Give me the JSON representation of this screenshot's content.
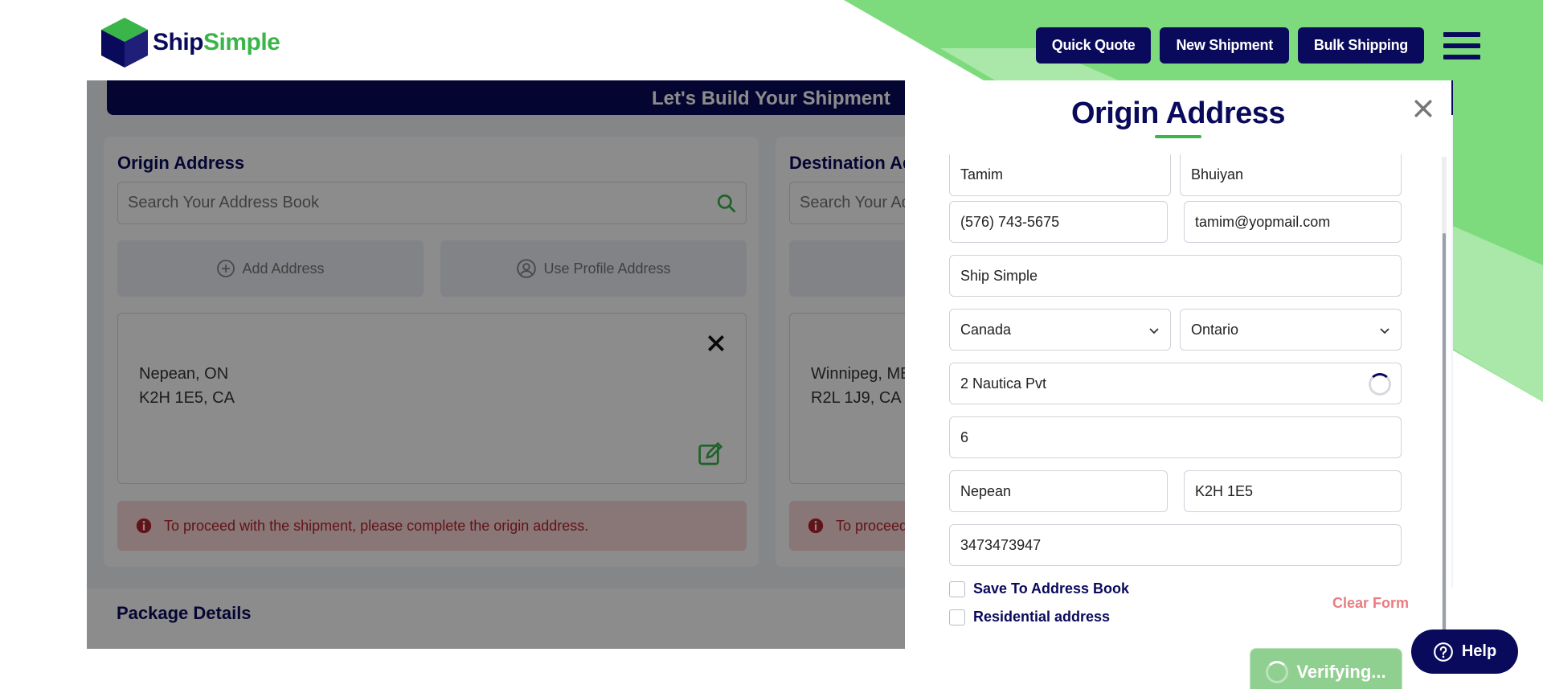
{
  "header": {
    "logo_ship": "Ship",
    "logo_simple": "Simple",
    "nav": [
      "Quick Quote",
      "New Shipment",
      "Bulk Shipping"
    ]
  },
  "banner": {
    "title": "Let's Build Your Shipment"
  },
  "origin_card": {
    "title": "Origin Address",
    "search_placeholder": "Search Your Address Book",
    "add_address": "Add Address",
    "use_profile": "Use Profile Address",
    "address_line1": "Nepean, ON",
    "address_line2": "K2H 1E5, CA",
    "alert": "To proceed with the shipment, please complete the origin address."
  },
  "destination_card": {
    "title": "Destination Ad",
    "search_placeholder": "Search Your Ad",
    "address_line1": "Winnipeg, MB",
    "address_line2": "R2L 1J9, CA",
    "alert": "To proceed"
  },
  "package": {
    "title": "Package Details"
  },
  "drawer": {
    "title": "Origin Address",
    "first_name": "Tamim",
    "last_name": "Bhuiyan",
    "phone": "(576) 743-5675",
    "email": "tamim@yopmail.com",
    "company": "Ship Simple",
    "country": "Canada",
    "province": "Ontario",
    "address1": "2 Nautica Pvt",
    "address2": "6",
    "city": "Nepean",
    "postal": "K2H 1E5",
    "phone2": "3473473947",
    "save_to_book": "Save To Address Book",
    "residential": "Residential address",
    "clear_form": "Clear Form"
  },
  "verify": {
    "label": "Verifying..."
  },
  "help": {
    "label": "Help"
  },
  "colors": {
    "navy": "#0a0a5c",
    "green": "#39b54a",
    "alert_bg": "#f9d7d8",
    "alert_text": "#b3242d"
  }
}
